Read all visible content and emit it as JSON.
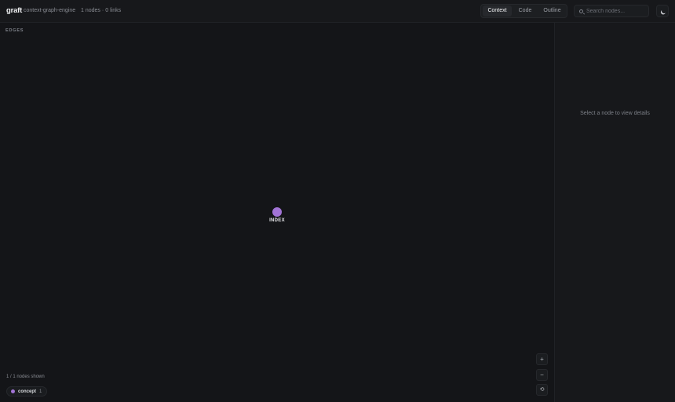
{
  "header": {
    "logo": "graft",
    "project": "context-graph-engine",
    "node_count": "1 nodes",
    "separator": "·",
    "link_count": "0 links",
    "tabs": [
      {
        "label": "Context",
        "active": true
      },
      {
        "label": "Code",
        "active": false
      },
      {
        "label": "Outline",
        "active": false
      }
    ],
    "search": {
      "placeholder": "Search nodes...",
      "value": "",
      "icon": "search-icon"
    },
    "theme_toggle_icon": "moon-icon"
  },
  "canvas": {
    "edges_label": "EDGES",
    "node": {
      "label": "INDEX",
      "type": "concept",
      "color": "#a274d6"
    },
    "shown_count": "1 / 1 nodes shown",
    "legend": [
      {
        "name": "concept",
        "count": "1",
        "color": "#a274d6"
      }
    ],
    "zoom_controls": {
      "zoom_in": "+",
      "zoom_out": "−",
      "reset": "⟲"
    }
  },
  "details": {
    "empty_message": "Select a node to view details"
  }
}
